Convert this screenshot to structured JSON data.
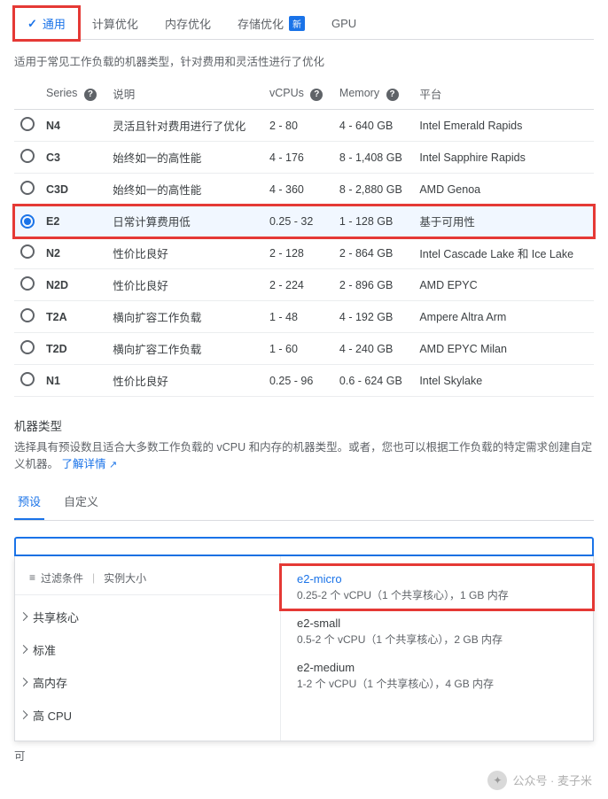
{
  "tabs": {
    "general": "通用",
    "compute": "计算优化",
    "memory": "内存优化",
    "storage": "存储优化",
    "storage_badge": "新",
    "gpu": "GPU"
  },
  "tab_desc": "适用于常见工作负载的机器类型，针对费用和灵活性进行了优化",
  "table": {
    "headers": {
      "series": "Series",
      "desc": "说明",
      "vcpus": "vCPUs",
      "memory": "Memory",
      "platform": "平台"
    },
    "rows": [
      {
        "series": "N4",
        "desc": "灵活且针对费用进行了优化",
        "vcpus": "2 - 80",
        "memory": "4 - 640 GB",
        "platform": "Intel Emerald Rapids",
        "selected": false
      },
      {
        "series": "C3",
        "desc": "始终如一的高性能",
        "vcpus": "4 - 176",
        "memory": "8 - 1,408 GB",
        "platform": "Intel Sapphire Rapids",
        "selected": false
      },
      {
        "series": "C3D",
        "desc": "始终如一的高性能",
        "vcpus": "4 - 360",
        "memory": "8 - 2,880 GB",
        "platform": "AMD Genoa",
        "selected": false
      },
      {
        "series": "E2",
        "desc": "日常计算费用低",
        "vcpus": "0.25 - 32",
        "memory": "1 - 128 GB",
        "platform": "基于可用性",
        "selected": true
      },
      {
        "series": "N2",
        "desc": "性价比良好",
        "vcpus": "2 - 128",
        "memory": "2 - 864 GB",
        "platform": "Intel Cascade Lake 和 Ice Lake",
        "selected": false
      },
      {
        "series": "N2D",
        "desc": "性价比良好",
        "vcpus": "2 - 224",
        "memory": "2 - 896 GB",
        "platform": "AMD EPYC",
        "selected": false
      },
      {
        "series": "T2A",
        "desc": "横向扩容工作负载",
        "vcpus": "1 - 48",
        "memory": "4 - 192 GB",
        "platform": "Ampere Altra Arm",
        "selected": false
      },
      {
        "series": "T2D",
        "desc": "横向扩容工作负载",
        "vcpus": "1 - 60",
        "memory": "4 - 240 GB",
        "platform": "AMD EPYC Milan",
        "selected": false
      },
      {
        "series": "N1",
        "desc": "性价比良好",
        "vcpus": "0.25 - 96",
        "memory": "0.6 - 624 GB",
        "platform": "Intel Skylake",
        "selected": false
      }
    ]
  },
  "machine_type": {
    "title": "机器类型",
    "desc": "选择具有预设数且适合大多数工作负载的 vCPU 和内存的机器类型。或者，您也可以根据工作负载的特定需求创建自定义机器。",
    "learn_more": "了解详情",
    "subtabs": {
      "preset": "预设",
      "custom": "自定义"
    }
  },
  "dropdown": {
    "filter_label": "过滤条件",
    "filter_value": "实例大小",
    "left_items": [
      "共享核心",
      "标准",
      "高内存",
      "高 CPU"
    ],
    "right_items": [
      {
        "name": "e2-micro",
        "spec": "0.25-2 个 vCPU（1 个共享核心），1 GB 内存",
        "highlight": true
      },
      {
        "name": "e2-small",
        "spec": "0.5-2 个 vCPU（1 个共享核心），2 GB 内存",
        "highlight": false
      },
      {
        "name": "e2-medium",
        "spec": "1-2 个 vCPU（1 个共享核心），4 GB 内存",
        "highlight": false
      }
    ]
  },
  "truncated_label": "可",
  "watermark": "公众号 · 麦子米"
}
